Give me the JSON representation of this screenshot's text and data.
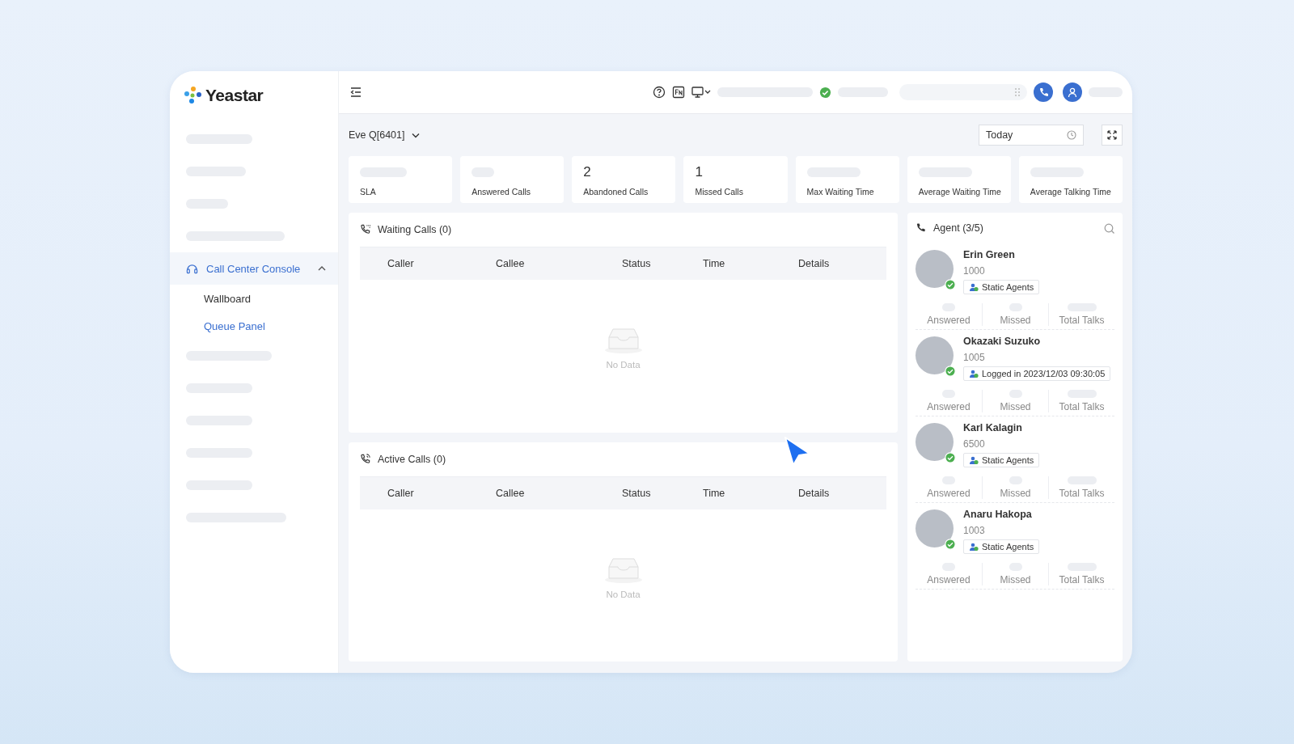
{
  "sidebar": {
    "logo": "Yeastar",
    "items": [
      {
        "kind": "skeleton"
      },
      {
        "kind": "skeleton"
      },
      {
        "kind": "skeleton"
      },
      {
        "kind": "skeleton"
      },
      {
        "kind": "group",
        "label": "Call Center Console",
        "expanded": true,
        "children": [
          {
            "label": "Wallboard",
            "selected": false
          },
          {
            "label": "Queue Panel",
            "selected": true
          }
        ]
      },
      {
        "kind": "skeleton"
      },
      {
        "kind": "skeleton"
      },
      {
        "kind": "skeleton"
      },
      {
        "kind": "skeleton"
      },
      {
        "kind": "skeleton"
      },
      {
        "kind": "skeleton"
      }
    ]
  },
  "topbar": {
    "status_online": true
  },
  "queue": {
    "name": "Eve Q[6401]",
    "date_range": "Today"
  },
  "stats": [
    {
      "label": "SLA"
    },
    {
      "label": "Answered Calls"
    },
    {
      "label": "Abandoned Calls",
      "value": "2"
    },
    {
      "label": "Missed Calls",
      "value": "1"
    },
    {
      "label": "Max Waiting Time"
    },
    {
      "label": "Average Waiting Time"
    },
    {
      "label": "Average Talking Time"
    }
  ],
  "panels": [
    {
      "kind": "waiting",
      "title": "Waiting Calls (0)",
      "columns": [
        "Caller",
        "Callee",
        "Status",
        "Time",
        "Details"
      ],
      "empty_text": "No Data"
    },
    {
      "kind": "active",
      "title": "Active Calls (0)",
      "columns": [
        "Caller",
        "Callee",
        "Status",
        "Time",
        "Details"
      ],
      "empty_text": "No Data"
    }
  ],
  "agents": {
    "title": "Agent (3/5)",
    "items": [
      {
        "name": "Erin Green",
        "extension": "1000",
        "online": true,
        "tag": "Static Agents",
        "metrics": [
          "Answered",
          "Missed",
          "Total Talks"
        ]
      },
      {
        "name": "Okazaki Suzuko",
        "extension": "1005",
        "online": true,
        "tag": "Logged in 2023/12/03 09:30:05",
        "metrics": [
          "Answered",
          "Missed",
          "Total Talks"
        ]
      },
      {
        "name": "Karl Kalagin",
        "extension": "6500",
        "online": true,
        "tag": "Static Agents",
        "metrics": [
          "Answered",
          "Missed",
          "Total Talks"
        ]
      },
      {
        "name": "Anaru Hakopa",
        "extension": "1003",
        "online": true,
        "tag": "Static Agents",
        "metrics": [
          "Answered",
          "Missed",
          "Total Talks"
        ]
      }
    ]
  }
}
